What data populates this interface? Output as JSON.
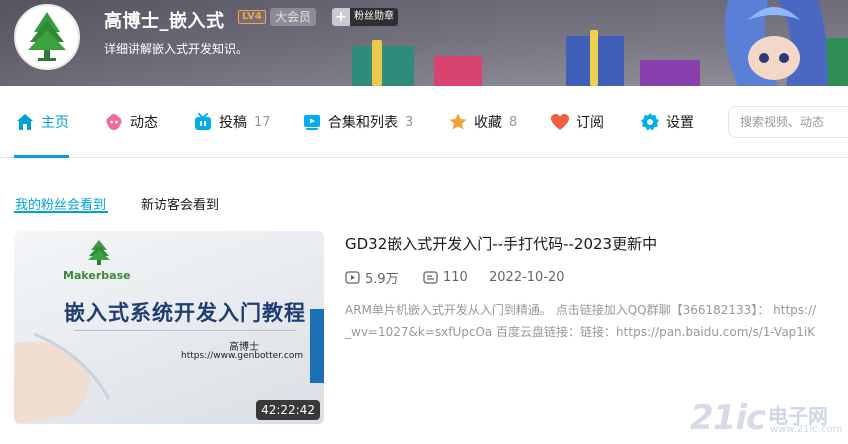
{
  "profile": {
    "name": "高博士_嵌入式",
    "level": "LV4",
    "vip": "大会员",
    "medal_plus": "+",
    "medal": "粉丝勋章",
    "sign": "详细讲解嵌入式开发知识。"
  },
  "nav": {
    "items": [
      {
        "label": "主页",
        "count": "",
        "icon": "home-icon"
      },
      {
        "label": "动态",
        "count": "",
        "icon": "dynamic-icon"
      },
      {
        "label": "投稿",
        "count": "17",
        "icon": "upload-icon"
      },
      {
        "label": "合集和列表",
        "count": "3",
        "icon": "collection-icon"
      },
      {
        "label": "收藏",
        "count": "8",
        "icon": "star-icon"
      },
      {
        "label": "订阅",
        "count": "",
        "icon": "heart-icon"
      },
      {
        "label": "设置",
        "count": "",
        "icon": "gear-icon"
      }
    ],
    "search_placeholder": "搜索视频、动态"
  },
  "subtabs": [
    "我的粉丝会看到",
    "新访客会看到"
  ],
  "video": {
    "thumb_brand": "Makerbase",
    "thumb_headline": "嵌入式系统开发入门教程",
    "thumb_author": "高博士",
    "thumb_site": "https://www.genbotter.com",
    "duration": "42:22:42",
    "title": "GD32嵌入式开发入门--手打代码--2023更新中",
    "views": "5.9万",
    "danmaku": "110",
    "date": "2022-10-20",
    "desc_line1": "ARM单片机嵌入式开发从入门到精通。 点击链接加入QQ群聊【366182133】： https://",
    "desc_line2": "_wv=1027&k=sxfUpcOa 百度云盘链接：链接：https://pan.baidu.com/s/1-Vap1iK"
  },
  "watermark": {
    "num": "21ic",
    "cn": "电子网",
    "url": "www.21ic.com"
  },
  "colors": {
    "accent": "#00a1d6"
  }
}
